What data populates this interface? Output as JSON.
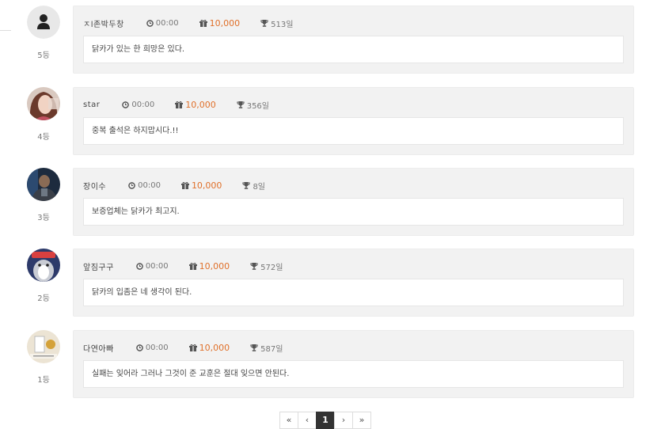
{
  "entries": [
    {
      "name": "ㅈl존박두창",
      "time": "00:00",
      "points": "10,000",
      "days": "513일",
      "message": "닭카가 있는 한 희망은 있다.",
      "rank": "5등",
      "avatar": "default-person"
    },
    {
      "name": "star",
      "time": "00:00",
      "points": "10,000",
      "days": "356일",
      "message": "중복 출석은 하지맙시다.!!",
      "rank": "4등",
      "avatar": "photo-woman"
    },
    {
      "name": "장이수",
      "time": "00:00",
      "points": "10,000",
      "days": "8일",
      "message": "보증업체는 닭카가 최고지.",
      "rank": "3등",
      "avatar": "photo-man"
    },
    {
      "name": "앞짐구구",
      "time": "00:00",
      "points": "10,000",
      "days": "572일",
      "message": "닭카의 입좀은 네 생각이 된다.",
      "rank": "2등",
      "avatar": "cartoon-penguin"
    },
    {
      "name": "다연아빠",
      "time": "00:00",
      "points": "10,000",
      "days": "587일",
      "message": "실패는 잊어라 그러나 그것이 준 교훈은 절대 잊으면 안된다.",
      "rank": "1등",
      "avatar": "photo-sign"
    }
  ],
  "pagination": {
    "first": "«",
    "prev": "‹",
    "current": "1",
    "next": "›",
    "last": "»"
  },
  "colors": {
    "points": "#e0702a",
    "card": "#f2f2f2",
    "active_page": "#333333"
  },
  "icons": {
    "time": "clock-icon",
    "points": "gift-icon",
    "days": "trophy-icon"
  }
}
